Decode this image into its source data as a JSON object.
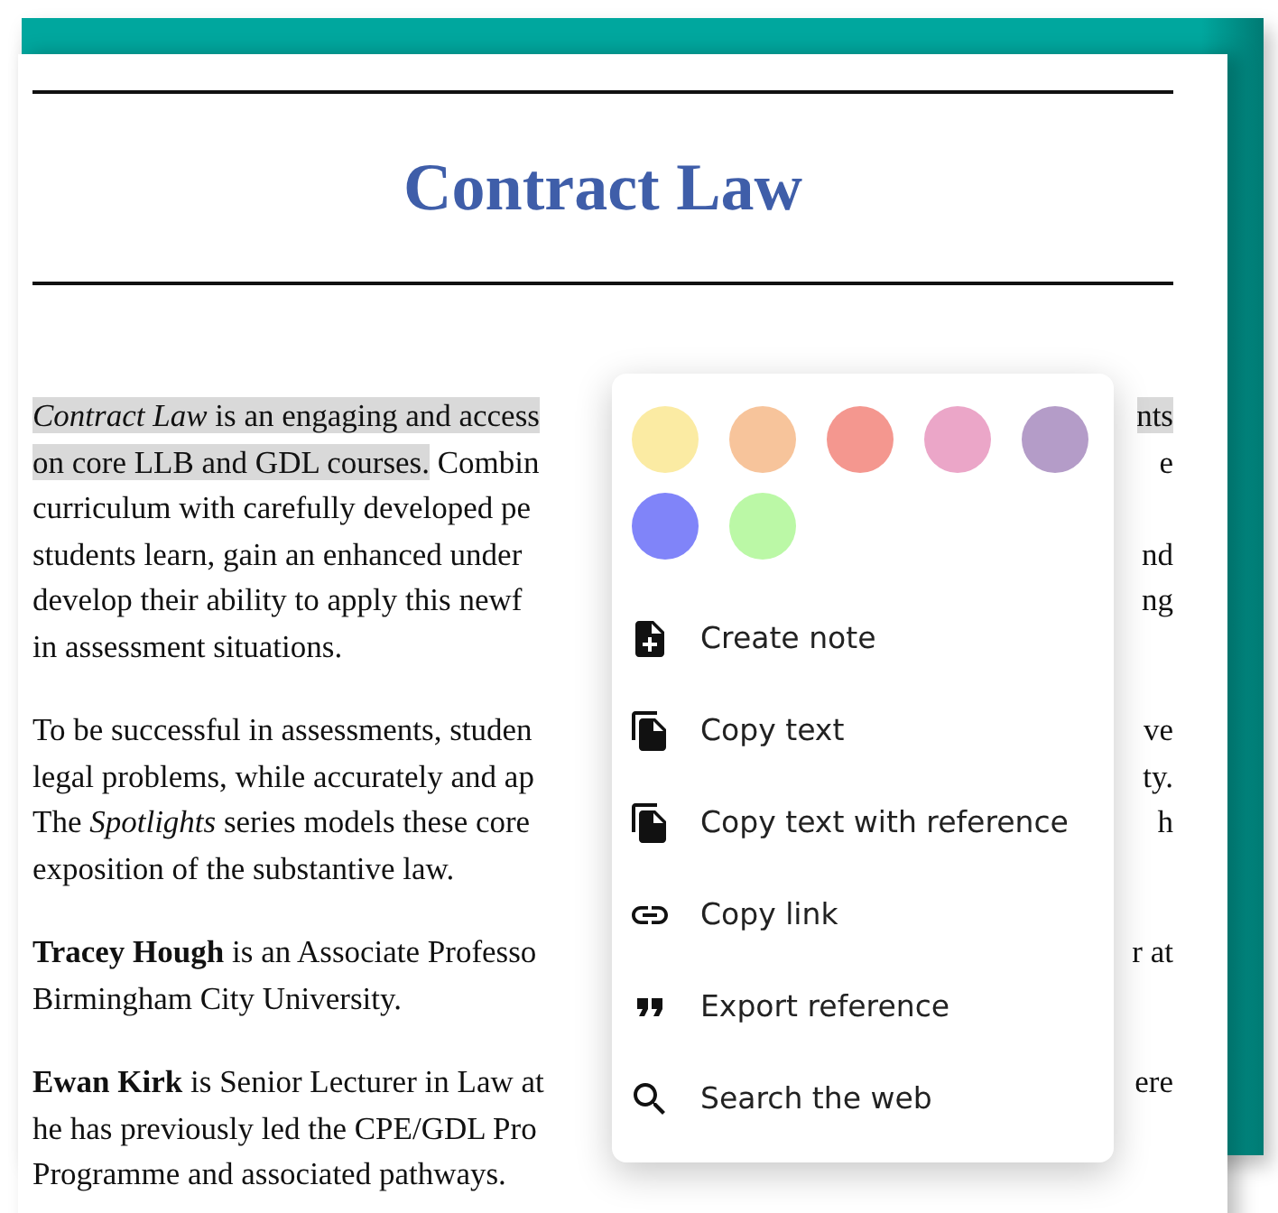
{
  "title": "Contract Law",
  "paragraphs": [
    {
      "lines": [
        {
          "left": [
            {
              "text": "*Contract Law* is an engaging and access",
              "highlighted": true
            }
          ],
          "right": [
            {
              "text": "nts",
              "highlighted": true
            }
          ]
        },
        {
          "left": [
            {
              "text": "on core LLB and GDL courses.",
              "highlighted": true
            },
            {
              "text": " Combin",
              "highlighted": false
            }
          ],
          "right": [
            {
              "text": "e",
              "highlighted": false
            }
          ]
        },
        {
          "left": [
            {
              "text": "curriculum with carefully developed pe",
              "highlighted": false
            }
          ]
        },
        {
          "left": [
            {
              "text": "students learn, gain an enhanced under",
              "highlighted": false
            }
          ],
          "right": [
            {
              "text": "nd",
              "highlighted": false
            }
          ]
        },
        {
          "left": [
            {
              "text": "develop their ability to apply this newf",
              "highlighted": false
            }
          ],
          "right": [
            {
              "text": "ng",
              "highlighted": false
            }
          ]
        },
        {
          "left": [
            {
              "text": "in assessment situations.",
              "highlighted": false
            }
          ]
        }
      ]
    },
    {
      "lines": [
        {
          "left": [
            {
              "text": "To be successful in assessments, studen",
              "highlighted": false
            }
          ],
          "right": [
            {
              "text": "ve",
              "highlighted": false
            }
          ]
        },
        {
          "left": [
            {
              "text": "legal problems, while accurately and ap",
              "highlighted": false
            }
          ],
          "right": [
            {
              "text": "ty.",
              "highlighted": false
            }
          ]
        },
        {
          "left": [
            {
              "text": "The *Spotlights* series models these core",
              "highlighted": false
            }
          ],
          "right": [
            {
              "text": "h",
              "highlighted": false
            }
          ]
        },
        {
          "left": [
            {
              "text": "exposition of the substantive law.",
              "highlighted": false
            }
          ]
        }
      ]
    },
    {
      "lines": [
        {
          "left": [
            {
              "text": "**Tracey Hough** is an Associate Professo",
              "highlighted": false
            }
          ],
          "right": [
            {
              "text": "r at",
              "highlighted": false
            }
          ]
        },
        {
          "left": [
            {
              "text": "Birmingham City University.",
              "highlighted": false
            }
          ]
        }
      ]
    },
    {
      "lines": [
        {
          "left": [
            {
              "text": "**Ewan Kirk** is Senior Lecturer in Law at",
              "highlighted": false
            }
          ],
          "right": [
            {
              "text": "ere",
              "highlighted": false
            }
          ]
        },
        {
          "left": [
            {
              "text": "he has previously led the CPE/GDL Pro",
              "highlighted": false
            }
          ]
        },
        {
          "left": [
            {
              "text": "Programme and associated pathways.",
              "highlighted": false
            }
          ]
        }
      ]
    }
  ],
  "menu": {
    "colors": [
      {
        "color": "#fbeba3"
      },
      {
        "color": "#f7c49b"
      },
      {
        "color": "#f4978f"
      },
      {
        "color": "#eba6c8"
      },
      {
        "color": "#b49cc8"
      },
      {
        "color": "#8084f9"
      },
      {
        "color": "#bbf8a6"
      }
    ],
    "items": [
      {
        "kind": "note",
        "label": "Create note"
      },
      {
        "kind": "copy",
        "label": "Copy text"
      },
      {
        "kind": "copy",
        "label": "Copy text with reference"
      },
      {
        "kind": "link",
        "label": "Copy link"
      },
      {
        "kind": "quote",
        "label": "Export reference"
      },
      {
        "kind": "search",
        "label": "Search the web"
      }
    ]
  }
}
